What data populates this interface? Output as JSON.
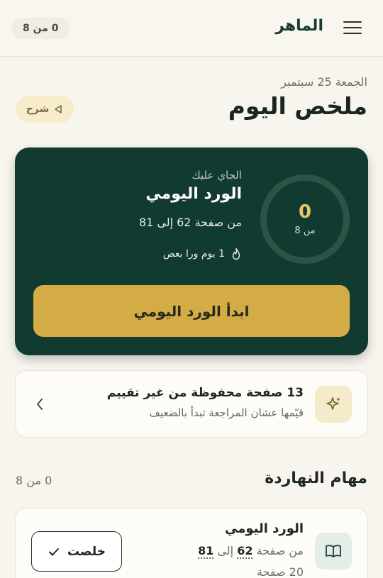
{
  "header": {
    "brand": "الماهر",
    "count_pill": "0 من 8"
  },
  "summary": {
    "date": "الجمعة 25 سبتمبر",
    "title": "ملخص اليوم",
    "explain_label": "شرح"
  },
  "daily_card": {
    "ring_value": "0",
    "ring_sub": "من 8",
    "progress_fraction": 0,
    "upcoming_label": "الجاي عليك",
    "title": "الورد اليومي",
    "range": "من صفحة 62 إلى 81",
    "streak": "1 يوم ورا بعض",
    "start_button": "ابدأ الورد اليومي"
  },
  "unrated_card": {
    "title": "13 صفحة محفوظة من غير تقييم",
    "subtitle": "قيّمها عشان المراجعة تبدأ بالضعيف"
  },
  "tasks": {
    "heading": "مهام النهاردة",
    "count": "0 من 8",
    "items": [
      {
        "title": "الورد اليومي",
        "range_prefix": "من صفحة",
        "range_start": "62",
        "range_mid": "إلى",
        "range_end": "81",
        "pages": "20 صفحة",
        "done_label": "خلصت"
      }
    ]
  },
  "colors": {
    "card_dark": "#113a30",
    "accent_gold": "#d4ac45",
    "background": "#f7f5ee"
  },
  "icons": {
    "menu": "hamburger-icon",
    "explain": "play-icon",
    "streak": "flame-icon",
    "unrated": "sparkle-icon",
    "chevron": "chevron-left-icon",
    "task": "book-icon",
    "done": "checkmark-icon"
  }
}
